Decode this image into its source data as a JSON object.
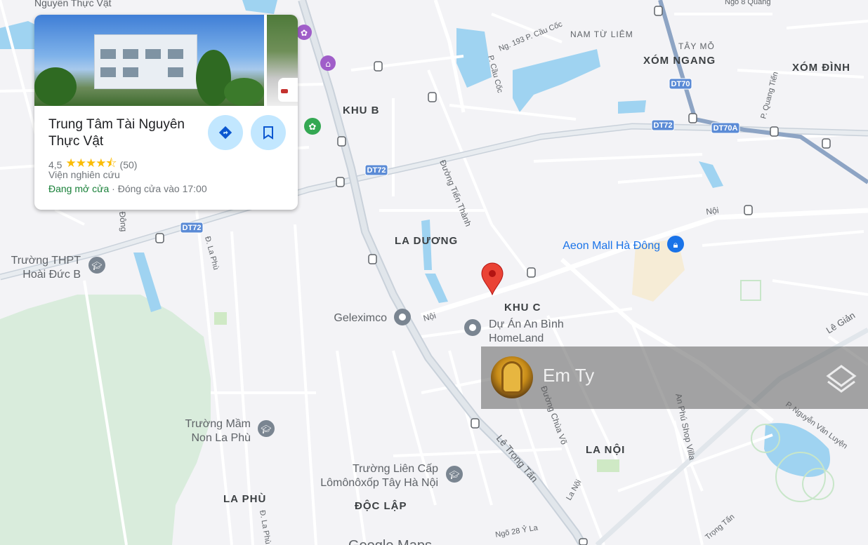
{
  "map": {
    "areas": {
      "xom_ngang": "XÓM NGANG",
      "xom_dinh": "XÓM ĐÌNH",
      "khu_b": "KHU B",
      "la_duong": "LA DƯƠNG",
      "khu_c": "KHU C",
      "la_noi": "LA NỘI",
      "la_phu": "LA PHÙ",
      "doc_lap": "ĐỘC LẬP",
      "nam_tu_liem": "NAM TỪ LIÊM",
      "tay_mo": "TÂY MỖ"
    },
    "streets": {
      "nguyen_thuc_vat": "Nguyễn Thực Vật",
      "ngo_8_quang": "Ngõ 8 Quang",
      "ng193_cau_coc": "Ng. 193 P. Cầu Cốc",
      "p_cau_coc": "P. Cầu Cốc",
      "p_quang_tien": "P. Quang Tiến",
      "duong_tien_thanh": "Đường Tiến Thành",
      "noi_east": "Nội",
      "noi_west": "Nội",
      "d_la_phu": "Đ. La Phù",
      "d_la_phu_south": "Đ. La Phù",
      "dong_fragment": "Đông",
      "le_gian": "Lê Giản",
      "le_trong_tan": "Lê Trọng Tấn",
      "duong_chua_vo": "Đường Chùa Võ",
      "an_phu_shop_villa": "An Phú Shop Villa",
      "p_nguyen_van_luyen": "P. Nguyễn Văn Luyện",
      "la_noi_small": "La Nội",
      "ngo_28_y_la": "Ngõ 28 Ỷ La",
      "trong_tan": "Trọng Tấn"
    },
    "shields": {
      "dt70": "DT70",
      "dt72_north": "DT72",
      "dt70a": "DT70A",
      "dt72_mid": "DT72",
      "dt72_west": "DT72"
    },
    "pois": {
      "aeon_mall": "Aeon Mall Hà Đông",
      "geleximco": "Geleximco",
      "du_an_an_binh_1": "Dự Án An Bình",
      "du_an_an_binh_2": "HomeLand",
      "thpt_hoai_duc_1": "Trường THPT",
      "thpt_hoai_duc_2": "Hoài Đức B",
      "mam_non_1": "Trường Mầm",
      "mam_non_2": "Non La Phù",
      "lien_cap_1": "Trường Liên Cấp",
      "lien_cap_2": "Lômônôxốp Tây Hà Nội",
      "google_maps": "Google Maps"
    },
    "colors": {
      "background": "#f3f3f6",
      "road": "#ffffff",
      "major_road": "#c9d1da",
      "water": "#9fd3f1",
      "park": "#d9ecdc",
      "shield": "#5b8bd6",
      "marker": "#ea4335"
    }
  },
  "place_card": {
    "name": "Trung Tâm Tài Nguyên Thực Vật",
    "rating": "4,5",
    "stars": "★★★★⯪",
    "review_count": "(50)",
    "category": "Viện nghiên cứu",
    "status_open": "Đang mở cửa",
    "status_separator": " · ",
    "closing_time": "Đóng cửa vào 17:00",
    "directions_icon": "directions-icon",
    "save_icon": "bookmark-icon"
  },
  "overlay": {
    "name": "Em Ty",
    "avatar_icon": "avatar",
    "logo_icon": "layers-logo-icon"
  }
}
